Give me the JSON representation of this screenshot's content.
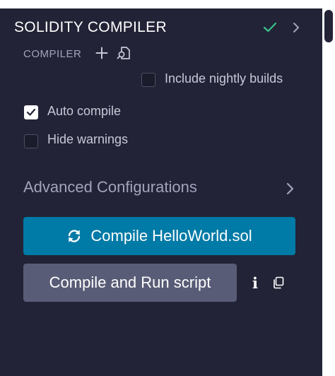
{
  "header": {
    "title": "SOLIDITY COMPILER",
    "status_icon": "check-icon",
    "status_color": "#3ac28a",
    "expand_icon": "chevron-right-icon"
  },
  "compiler_section": {
    "label": "COMPILER",
    "add_icon": "plus-icon",
    "custom_icon": "file-search-icon"
  },
  "options": {
    "include_nightly": {
      "label": "Include nightly builds",
      "checked": false
    },
    "auto_compile": {
      "label": "Auto compile",
      "checked": true
    },
    "hide_warnings": {
      "label": "Hide warnings",
      "checked": false
    }
  },
  "advanced": {
    "label": "Advanced Configurations",
    "icon": "chevron-right-icon"
  },
  "compile_button": {
    "label": "Compile HelloWorld.sol",
    "icon": "sync-icon",
    "color": "#007aa6"
  },
  "run_button": {
    "label": "Compile and Run script",
    "color": "#595c76"
  },
  "run_actions": {
    "info_glyph": "i",
    "copy_icon": "copy-icon"
  },
  "theme": {
    "panel_bg": "#222336",
    "text_muted": "#a2a3bd"
  }
}
